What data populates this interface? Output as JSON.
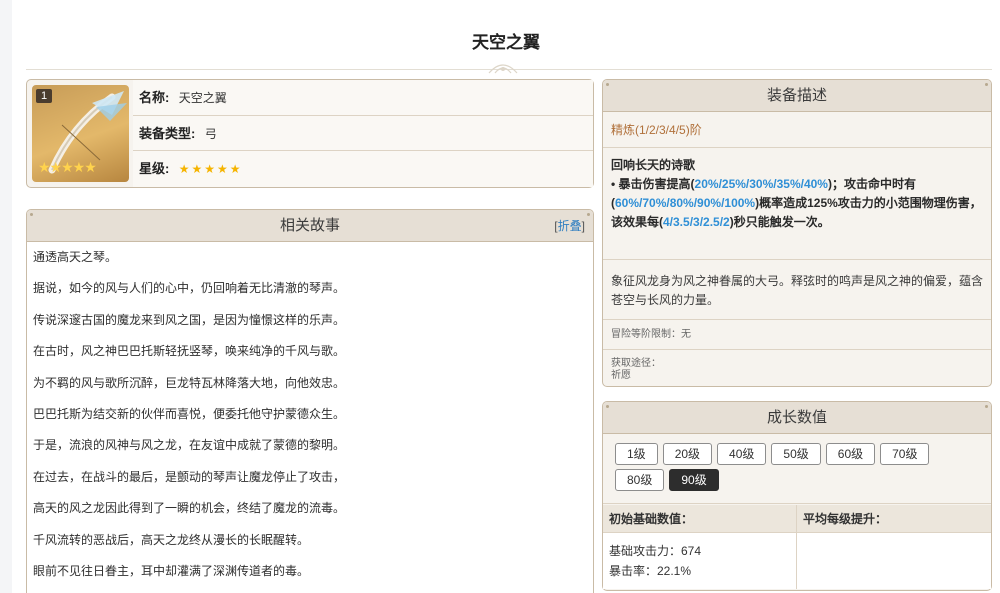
{
  "page_title": "天空之翼",
  "info": {
    "thumb_badge": "1",
    "thumb_stars": "★★★★★",
    "name_label": "名称:",
    "name_value": "天空之翼",
    "type_label": "装备类型:",
    "type_value": "弓",
    "rarity_label": "星级:",
    "rarity_stars": "★★★★★"
  },
  "story": {
    "title": "相关故事",
    "fold_open": "[",
    "fold_text": "折叠",
    "fold_close": "]",
    "lines": [
      "通透高天之琴。",
      "据说，如今的风与人们的心中，仍回响着无比清澈的琴声。",
      "传说深邃古国的魔龙来到风之国，是因为憧憬这样的乐声。",
      "在古时，风之神巴巴托斯轻抚竖琴，唤来纯净的千风与歌。",
      "为不羁的风与歌所沉醉，巨龙特瓦林降落大地，向他效忠。",
      "巴巴托斯为结交新的伙伴而喜悦，便委托他守护蒙德众生。",
      "于是，流浪的风神与风之龙，在友谊中成就了蒙德的黎明。",
      "在过去，在战斗的最后，是颤动的琴声让魔龙停止了攻击，",
      "高天的风之龙因此得到了一瞬的机会，终结了魔龙的流毒。",
      "千风流转的恶战后，高天之龙终从漫长的长眠醒转。",
      "眼前不见往日眷主，耳中却灌满了深渊传道者的毒。"
    ]
  },
  "desc": {
    "title": "装备描述",
    "refine": "精炼(1/2/3/4/5)阶",
    "skill_name": "回响长天的诗歌",
    "skill_p1": "• 暴击伤害提高(",
    "skill_h1": "20%/25%/30%/35%/40%",
    "skill_p2": ")；攻击命中时有(",
    "skill_h2": "60%/70%/80%/90%/100%",
    "skill_p3": ")概率造成125%攻击力的小范围物理伤害，该效果每(",
    "skill_h3": "4/3.5/3/2.5/2",
    "skill_p4": ")秒只能触发一次。",
    "flavor": "象征风龙身为风之神眷属的大弓。释弦时的鸣声是风之神的偏爱，蕴含苍空与长风的力量。",
    "limit": "冒险等阶限制：无",
    "source_label": "获取途径：",
    "source_value": "祈愿"
  },
  "growth": {
    "title": "成长数值",
    "levels": [
      "1级",
      "20级",
      "40级",
      "50级",
      "60级",
      "70级",
      "80级",
      "90级"
    ],
    "active_level": "90级",
    "base_header": "初始基础数值：",
    "avg_header": "平均每级提升：",
    "atk": "基础攻击力：674",
    "crit": "暴击率：22.1%"
  },
  "colors": {
    "panel_border": "#c9bba6",
    "panel_head": "#e6dfd5",
    "highlight": "#2f8fd6",
    "refine": "#b0703a",
    "active_level": "#2d2d2d"
  }
}
